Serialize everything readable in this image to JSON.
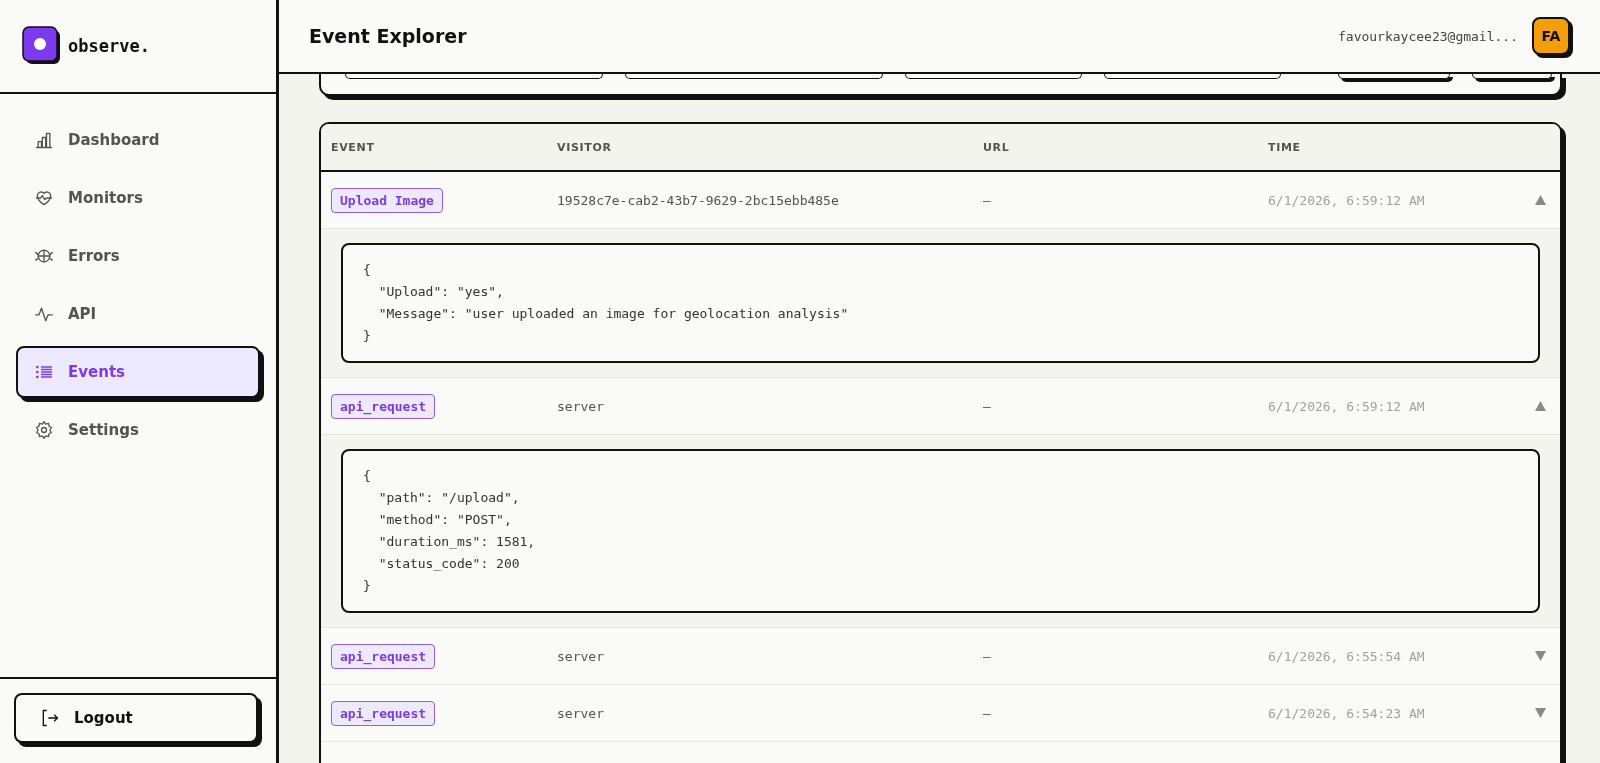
{
  "sidebar": {
    "logo": "observe.",
    "items": [
      {
        "label": "Dashboard",
        "selected": false
      },
      {
        "label": "Monitors",
        "selected": false
      },
      {
        "label": "Errors",
        "selected": false
      },
      {
        "label": "API",
        "selected": false
      },
      {
        "label": "Events",
        "selected": true
      },
      {
        "label": "Settings",
        "selected": false
      }
    ],
    "logout": "Logout"
  },
  "header": {
    "title": "Event Explorer",
    "email": "favourkaycee23@gmail...",
    "avatar": "FA"
  },
  "table": {
    "columns": [
      "EVENT",
      "VISITOR",
      "URL",
      "TIME"
    ],
    "rows": [
      {
        "event": "Upload Image",
        "visitor": "19528c7e-cab2-43b7-9629-2bc15ebb485e",
        "url": "—",
        "time": "6/1/2026, 6:59:12 AM",
        "expanded": true,
        "payload": "{\n  \"Upload\": \"yes\",\n  \"Message\": \"user uploaded an image for geolocation analysis\"\n}"
      },
      {
        "event": "api_request",
        "visitor": "server",
        "url": "—",
        "time": "6/1/2026, 6:59:12 AM",
        "expanded": true,
        "payload": "{\n  \"path\": \"/upload\",\n  \"method\": \"POST\",\n  \"duration_ms\": 1581,\n  \"status_code\": 200\n}"
      },
      {
        "event": "api_request",
        "visitor": "server",
        "url": "—",
        "time": "6/1/2026, 6:55:54 AM",
        "expanded": false
      },
      {
        "event": "api_request",
        "visitor": "server",
        "url": "—",
        "time": "6/1/2026, 6:54:23 AM",
        "expanded": false
      }
    ]
  }
}
